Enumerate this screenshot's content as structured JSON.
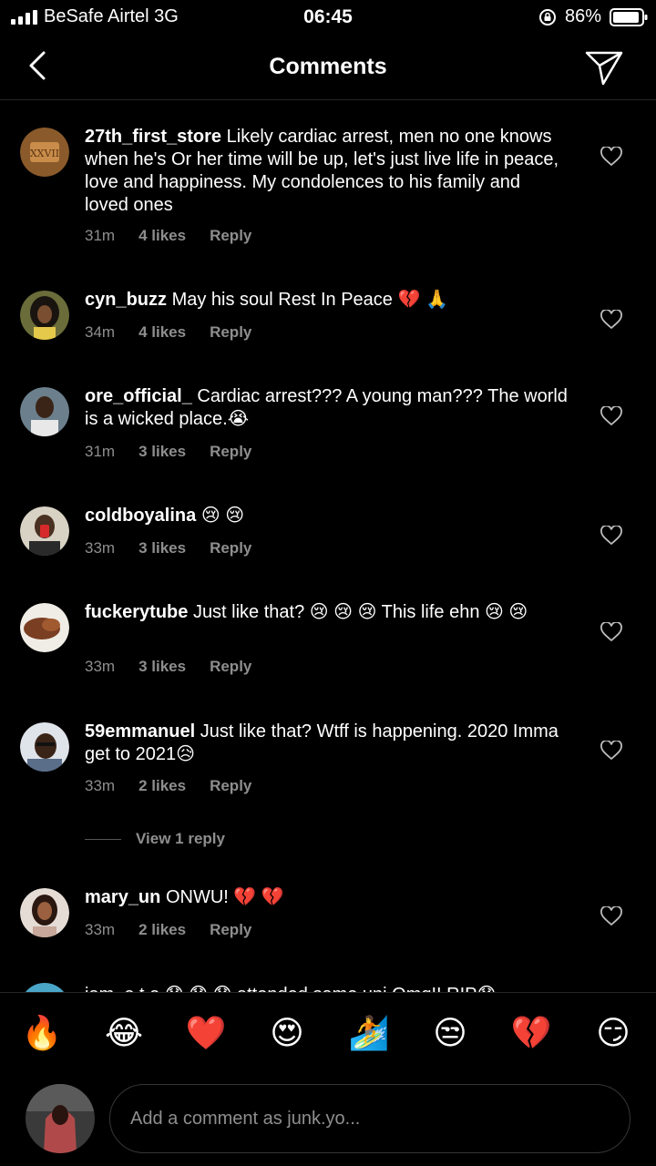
{
  "status_bar": {
    "carrier": "BeSafe Airtel  3G",
    "time": "06:45",
    "battery": "86%"
  },
  "header": {
    "title": "Comments",
    "back_icon": "chevron-left-icon",
    "send_icon": "paper-plane-icon"
  },
  "comments": [
    {
      "username": "27th_first_store",
      "text": "Likely cardiac arrest, men no one knows when he's Or her time will be up, let's just live life in peace, love and happiness. My condolences to his family and loved ones",
      "time": "31m",
      "likes": "4 likes",
      "reply": "Reply"
    },
    {
      "username": "cyn_buzz",
      "text": "May his soul Rest In Peace 💔 🙏",
      "time": "34m",
      "likes": "4 likes",
      "reply": "Reply"
    },
    {
      "username": "ore_official_",
      "text": "Cardiac arrest??? A young man??? The world is a wicked place.😭",
      "time": "31m",
      "likes": "3 likes",
      "reply": "Reply"
    },
    {
      "username": "coldboyalina",
      "text": "😢 😢",
      "time": "33m",
      "likes": "3 likes",
      "reply": "Reply"
    },
    {
      "username": "fuckerytube",
      "text": "Just like that? 😢 😢 😢  This life ehn  😢 😢",
      "time": "33m",
      "likes": "3 likes",
      "reply": "Reply"
    },
    {
      "username": "59emmanuel",
      "text": "Just like that? Wtff is happening. 2020 Imma get to 2021😥",
      "time": "33m",
      "likes": "2 likes",
      "reply": "Reply"
    },
    {
      "username": "mary_un",
      "text": "ONWU! 💔 💔",
      "time": "33m",
      "likes": "2 likes",
      "reply": "Reply"
    }
  ],
  "view_replies": "View 1 reply",
  "partial_comment": "iam_e.t.e 😓 😓 😓  attended same uni Omg!! RIP😓",
  "emoji_bar": [
    "🔥",
    "😂",
    "❤️",
    "😍",
    "🏄",
    "😒",
    "💔",
    "😏"
  ],
  "composer": {
    "placeholder": "Add a comment as junk.yo..."
  },
  "colors": {
    "background": "#000000",
    "secondary_text": "#8e8e8e",
    "divider": "#262626"
  }
}
